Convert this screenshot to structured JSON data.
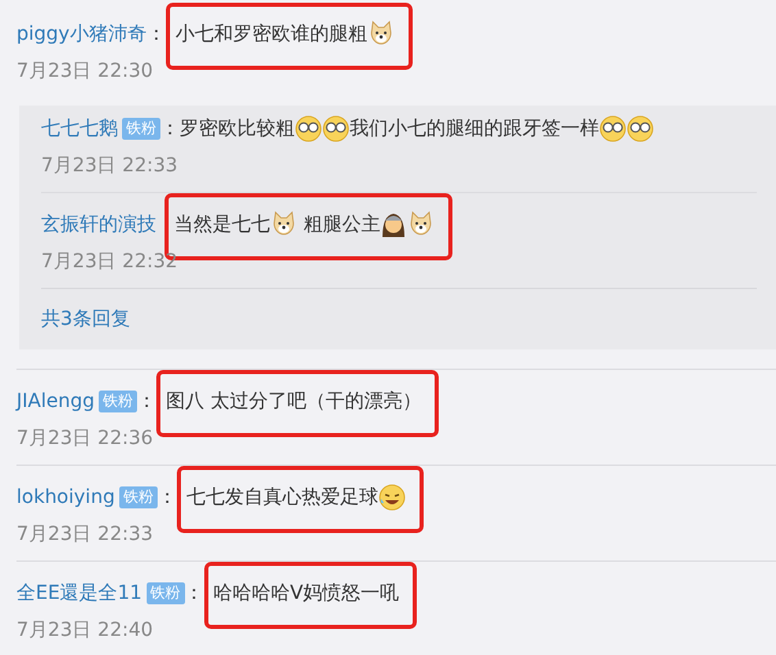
{
  "comment": {
    "name": "piggy小猪沛奇",
    "colon": "：",
    "highlighted": true,
    "message": [
      {
        "kind": "text",
        "text": "小七和罗密欧谁的腿粗"
      },
      {
        "kind": "dog"
      }
    ],
    "time": "7月23日 22:30",
    "replies": [
      {
        "name": "七七七鹅",
        "badge": "铁粉",
        "colon": "：",
        "highlighted": false,
        "message": [
          {
            "kind": "text",
            "text": "罗密欧比较粗"
          },
          {
            "kind": "glasses"
          },
          {
            "kind": "glasses"
          },
          {
            "kind": "text",
            "text": "我们小七的腿细的跟牙签一样"
          },
          {
            "kind": "glasses"
          },
          {
            "kind": "glasses"
          }
        ],
        "time": "7月23日 22:33"
      },
      {
        "name": "玄振轩的演技",
        "highlighted": true,
        "message": [
          {
            "kind": "text",
            "text": "当然是七七"
          },
          {
            "kind": "dog"
          },
          {
            "kind": "text",
            "text": " 粗腿公主"
          },
          {
            "kind": "girl"
          },
          {
            "kind": "dog"
          }
        ],
        "time": "7月23日 22:32"
      }
    ],
    "more": "共3条回复"
  },
  "comments": [
    {
      "name": "JIAlengg",
      "badge": "铁粉",
      "colon": "：",
      "highlighted": true,
      "message": [
        {
          "kind": "text",
          "text": "图八 太过分了吧（干的漂亮）"
        }
      ],
      "time": "7月23日 22:36"
    },
    {
      "name": "lokhoiying",
      "badge": "铁粉",
      "colon": "：",
      "highlighted": true,
      "message": [
        {
          "kind": "text",
          "text": "七七发自真心热爱足球"
        },
        {
          "kind": "laugh"
        }
      ],
      "time": "7月23日 22:33"
    },
    {
      "name": "全EE還是全11",
      "badge": "铁粉",
      "colon": "：",
      "highlighted": true,
      "message": [
        {
          "kind": "text",
          "text": "哈哈哈哈V妈愤怒一吼"
        }
      ],
      "time": "7月23日 22:40"
    }
  ]
}
